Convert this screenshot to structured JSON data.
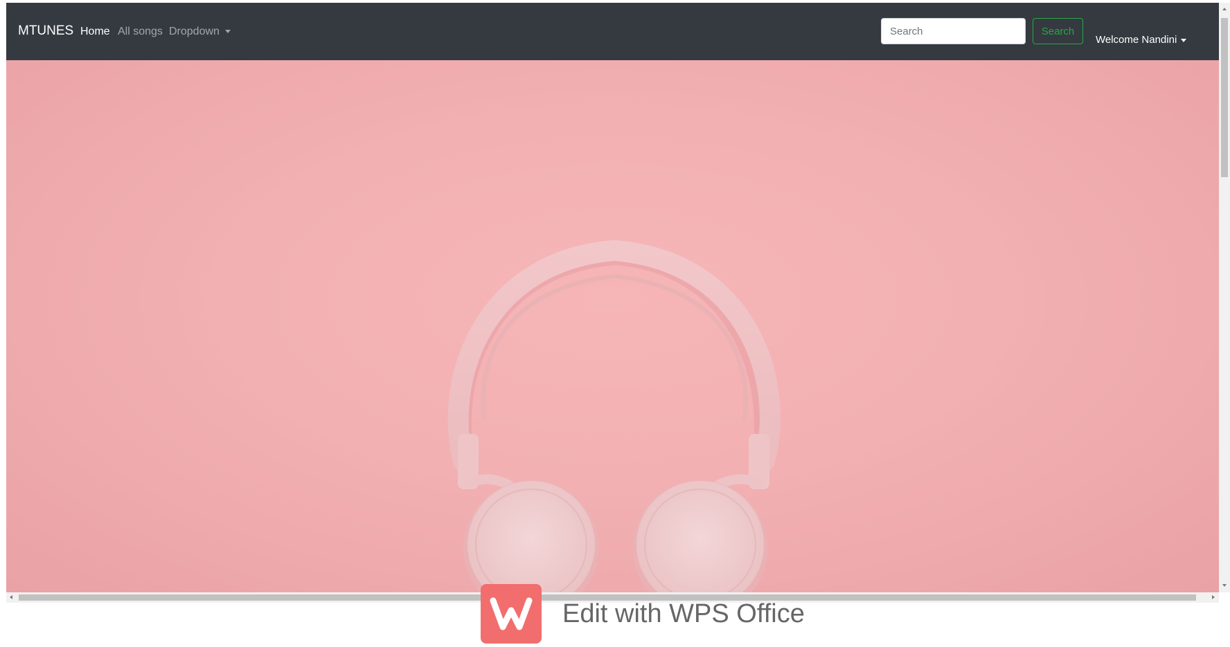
{
  "navbar": {
    "brand": "MTUNES",
    "links": [
      {
        "label": "Home",
        "active": true
      },
      {
        "label": "All songs",
        "active": false
      },
      {
        "label": "Dropdown",
        "active": false
      }
    ],
    "search": {
      "placeholder": "Search",
      "button_label": "Search"
    },
    "user_menu": "Welcome Nandini"
  },
  "hero": {
    "image": "pink-headphones-background"
  },
  "watermark": {
    "text": "Edit with WPS Office"
  },
  "colors": {
    "navbar_bg": "#343a40",
    "search_button": "#28a745",
    "hero_bg": "#f4b3b5",
    "wps_red": "#f26d6d"
  }
}
